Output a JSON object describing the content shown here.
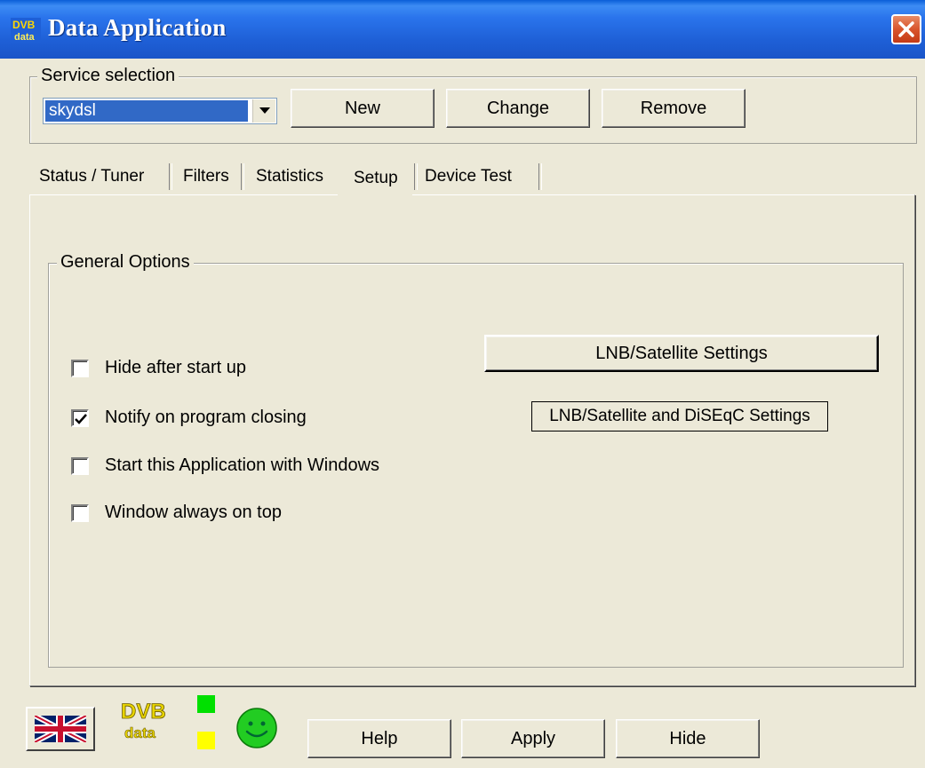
{
  "window": {
    "title": "Data Application",
    "icon_name": "dvb-app-icon",
    "close_icon": "close-icon"
  },
  "service_selection": {
    "legend": "Service selection",
    "selected": "skydsl",
    "buttons": {
      "new": "New",
      "change": "Change",
      "remove": "Remove"
    }
  },
  "tabs": {
    "items": [
      "Status / Tuner",
      "Filters",
      "Statistics",
      "Setup",
      "Device Test"
    ],
    "active": "Setup"
  },
  "general_options": {
    "legend": "General Options",
    "checkboxes": [
      {
        "label": "Hide after start up",
        "checked": false
      },
      {
        "label": "Notify on program closing",
        "checked": true
      },
      {
        "label": "Start this Application with Windows",
        "checked": false
      },
      {
        "label": "Window always on top",
        "checked": false
      }
    ],
    "lnb_button": "LNB/Satellite Settings",
    "diseqc_button": "LNB/Satellite and DiSEqC Settings"
  },
  "footer": {
    "logo_text_top": "DVB",
    "logo_text_bottom": "data",
    "status_leds": {
      "top_color": "#00E000",
      "bottom_color": "#FFFF00"
    },
    "buttons": {
      "help": "Help",
      "apply": "Apply",
      "hide": "Hide"
    },
    "language_icon": "uk-flag-icon",
    "status_icon": "smiley-icon"
  },
  "colors": {
    "titlebar": "#1E5FD6",
    "selection": "#3169C6",
    "face": "#ECE9D8"
  }
}
